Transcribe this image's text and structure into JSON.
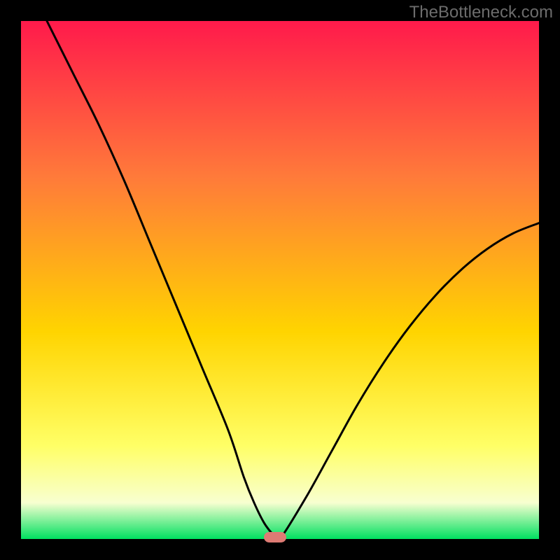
{
  "watermark": "TheBottleneck.com",
  "colors": {
    "gradient_top": "#ff1a4b",
    "gradient_mid1": "#ff7a3a",
    "gradient_mid2": "#ffd400",
    "gradient_low": "#ffff66",
    "gradient_pale": "#f8ffd0",
    "gradient_bottom": "#00e060",
    "curve": "#000000",
    "marker": "#de7b74",
    "background": "#000000",
    "watermark": "#6c6c6c"
  },
  "chart_data": {
    "type": "line",
    "title": "",
    "xlabel": "",
    "ylabel": "",
    "xlim": [
      0,
      100
    ],
    "ylim": [
      0,
      100
    ],
    "series": [
      {
        "name": "bottleneck-curve",
        "x": [
          5,
          10,
          15,
          20,
          25,
          30,
          35,
          40,
          43,
          45,
          47,
          49,
          50,
          55,
          60,
          65,
          70,
          75,
          80,
          85,
          90,
          95,
          100
        ],
        "values": [
          100,
          90,
          80,
          69,
          57,
          45,
          33,
          21,
          12,
          7,
          3,
          0.5,
          0,
          8,
          17,
          26,
          34,
          41,
          47,
          52,
          56,
          59,
          61
        ]
      }
    ],
    "marker": {
      "x": 49,
      "y": 0
    },
    "notes": "No axis ticks or numeric labels are rendered; values are visual estimates from curve shape and gradient scale."
  }
}
